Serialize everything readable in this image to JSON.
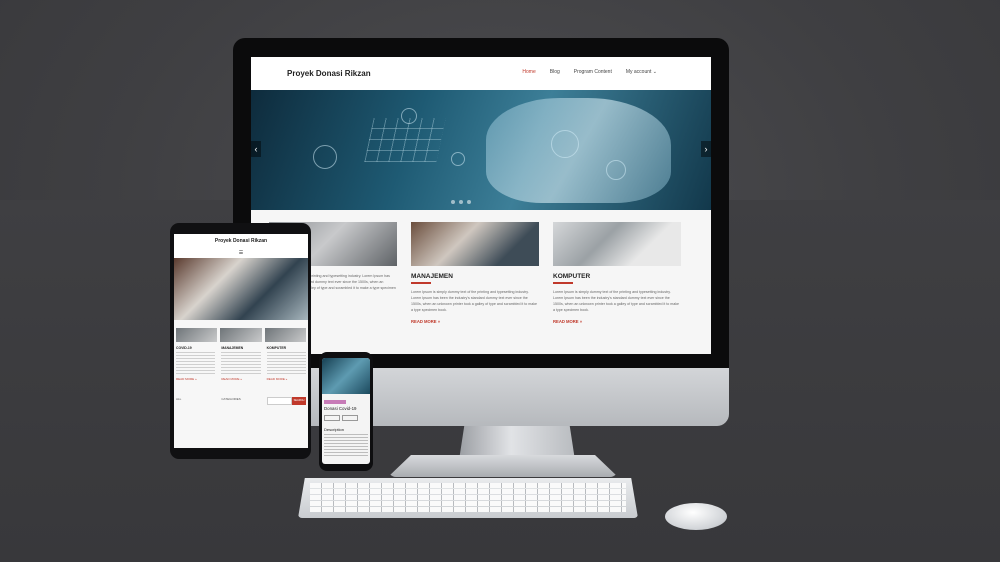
{
  "desktop": {
    "brand": "Proyek Donasi Rikzan",
    "menu": [
      {
        "label": "Home",
        "active": true
      },
      {
        "label": "Blog",
        "active": false
      },
      {
        "label": "Program Content",
        "active": false
      },
      {
        "label": "My account ⌄",
        "active": false
      }
    ],
    "hero": {
      "prev_icon": "chevron-left-icon",
      "next_icon": "chevron-right-icon"
    },
    "cards": [
      {
        "title": "",
        "text": "simply dummy text of the printing and typesetting industry. Lorem Ipsum has been the industry's standard dummy text ever since the 1500s, when an unknown printer took a galley of type and scrambled it to make a type specimen book.",
        "link": ""
      },
      {
        "title": "MANAJEMEN",
        "text": "Lorem Ipsum is simply dummy text of the printing and typesetting industry. Lorem Ipsum has been the industry's standard dummy text ever since the 1500s, when an unknown printer took a galley of type and scrambled it to make a type specimen book.",
        "link": "READ MORE »"
      },
      {
        "title": "KOMPUTER",
        "text": "Lorem Ipsum is simply dummy text of the printing and typesetting industry. Lorem Ipsum has been the industry's standard dummy text ever since the 1500s, when an unknown printer took a galley of type and scrambled it to make a type specimen book.",
        "link": "READ MORE »"
      }
    ]
  },
  "tablet": {
    "brand": "Proyek Donasi Rikzan",
    "menu_icon": "☰",
    "columns": [
      {
        "title": "COVID-19",
        "link": "READ MORE »"
      },
      {
        "title": "MANAJEMEN",
        "link": "READ MORE »"
      },
      {
        "title": "KOMPUTER",
        "link": "READ MORE »"
      }
    ],
    "footer_left": "ALL",
    "footer_mid": "CATEGORIES",
    "search_button": "SEARCH"
  },
  "phone": {
    "title": "Donasi Covid-19",
    "description": "Description"
  },
  "colors": {
    "accent": "#c0392b",
    "tag": "#c77bb7"
  }
}
